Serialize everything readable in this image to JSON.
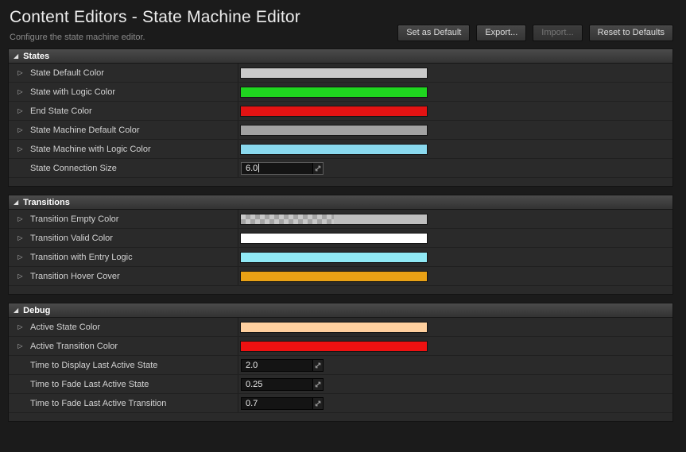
{
  "header": {
    "title": "Content Editors - State Machine Editor",
    "subtitle": "Configure the state machine editor.",
    "buttons": [
      {
        "label": "Set as Default",
        "enabled": true
      },
      {
        "label": "Export...",
        "enabled": true
      },
      {
        "label": "Import...",
        "enabled": false
      },
      {
        "label": "Reset to Defaults",
        "enabled": true
      }
    ]
  },
  "icons": {
    "section_expanded": "◢",
    "row_collapsed": "▷"
  },
  "sections": [
    {
      "title": "States",
      "rows": [
        {
          "label": "State Default Color",
          "type": "color",
          "color": "#cacaca",
          "overlay": "#cacaca"
        },
        {
          "label": "State with Logic Color",
          "type": "color",
          "color": "#1fd61f",
          "overlay": "#1fd61f"
        },
        {
          "label": "End State Color",
          "type": "color",
          "color": "#e31313",
          "overlay": "#e31313"
        },
        {
          "label": "State Machine Default Color",
          "type": "color",
          "color": "#a2a2a2",
          "overlay": "#a2a2a2"
        },
        {
          "label": "State Machine with Logic Color",
          "type": "color",
          "color": "#8ad9ee",
          "overlay": "#8ad9ee"
        },
        {
          "label": "State Connection Size",
          "type": "number",
          "value": "6.0",
          "focused": true
        }
      ]
    },
    {
      "title": "Transitions",
      "rows": [
        {
          "label": "Transition Empty Color",
          "type": "color",
          "color": "#bebebe",
          "overlay": "rgba(190,190,190,0.45)"
        },
        {
          "label": "Transition Valid Color",
          "type": "color",
          "color": "#ffffff",
          "overlay": "#ffffff"
        },
        {
          "label": "Transition with Entry Logic",
          "type": "color",
          "color": "#90e9f5",
          "overlay": "#90e9f5"
        },
        {
          "label": "Transition Hover Cover",
          "type": "color",
          "color": "#e9a115",
          "overlay": "#e9a115"
        }
      ]
    },
    {
      "title": "Debug",
      "rows": [
        {
          "label": "Active State Color",
          "type": "color",
          "color": "#ffd09f",
          "overlay": "#ffd09f"
        },
        {
          "label": "Active Transition Color",
          "type": "color",
          "color": "#ee1111",
          "overlay": "#ee1111"
        },
        {
          "label": "Time to Display Last Active State",
          "type": "number",
          "value": "2.0"
        },
        {
          "label": "Time to Fade Last Active State",
          "type": "number",
          "value": "0.25"
        },
        {
          "label": "Time to Fade Last Active Transition",
          "type": "number",
          "value": "0.7"
        }
      ]
    }
  ]
}
